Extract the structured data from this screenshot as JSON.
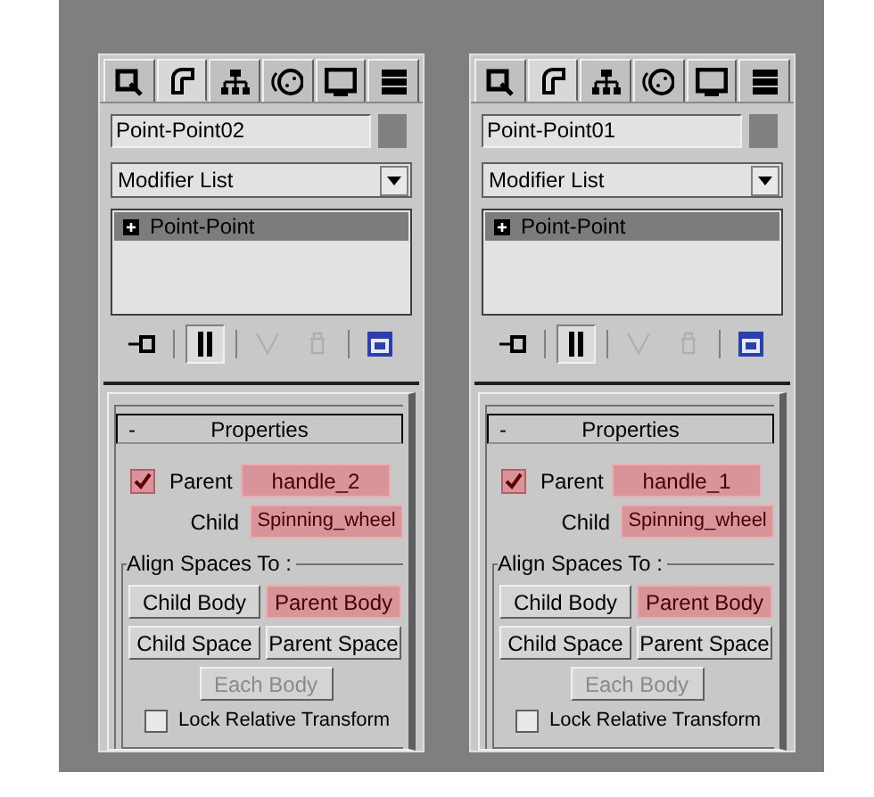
{
  "panels": [
    {
      "tabs": [
        {
          "kind": "create",
          "selected": false
        },
        {
          "kind": "modify",
          "selected": true
        },
        {
          "kind": "hierarchy",
          "selected": false
        },
        {
          "kind": "motion",
          "selected": false
        },
        {
          "kind": "display",
          "selected": false
        },
        {
          "kind": "utilities",
          "selected": false
        }
      ],
      "object_name": "Point-Point02",
      "modifier_list": "Modifier List",
      "stack": [
        {
          "label": "Point-Point",
          "selected": true
        }
      ],
      "toolbar": [
        {
          "kind": "pin",
          "pressed": false,
          "disabled": false
        },
        {
          "kind": "end-result",
          "pressed": true,
          "disabled": false
        },
        {
          "kind": "unique",
          "pressed": false,
          "disabled": true
        },
        {
          "kind": "remove",
          "pressed": false,
          "disabled": true
        },
        {
          "kind": "configure",
          "pressed": false,
          "disabled": false
        }
      ],
      "rollout": {
        "toggle": "-",
        "title": "Properties",
        "parent_checked": true,
        "parent_label": "Parent",
        "parent_value": "handle_2",
        "child_label": "Child",
        "child_value": "Spinning_wheel",
        "align_label": "Align Spaces To :",
        "buttons": [
          {
            "label": "Child Body",
            "selected": false,
            "disabled": false
          },
          {
            "label": "Parent Body",
            "selected": true,
            "disabled": false
          },
          {
            "label": "Child Space",
            "selected": false,
            "disabled": false
          },
          {
            "label": "Parent Space",
            "selected": false,
            "disabled": false
          },
          {
            "label": "Each Body",
            "selected": false,
            "disabled": true
          }
        ],
        "lock_checked": false,
        "lock_label": "Lock Relative Transform"
      }
    },
    {
      "tabs": [
        {
          "kind": "create",
          "selected": false
        },
        {
          "kind": "modify",
          "selected": true
        },
        {
          "kind": "hierarchy",
          "selected": false
        },
        {
          "kind": "motion",
          "selected": false
        },
        {
          "kind": "display",
          "selected": false
        },
        {
          "kind": "utilities",
          "selected": false
        }
      ],
      "object_name": "Point-Point01",
      "modifier_list": "Modifier List",
      "stack": [
        {
          "label": "Point-Point",
          "selected": true
        }
      ],
      "toolbar": [
        {
          "kind": "pin",
          "pressed": false,
          "disabled": false
        },
        {
          "kind": "end-result",
          "pressed": true,
          "disabled": false
        },
        {
          "kind": "unique",
          "pressed": false,
          "disabled": true
        },
        {
          "kind": "remove",
          "pressed": false,
          "disabled": true
        },
        {
          "kind": "configure",
          "pressed": false,
          "disabled": false
        }
      ],
      "rollout": {
        "toggle": "-",
        "title": "Properties",
        "parent_checked": true,
        "parent_label": "Parent",
        "parent_value": "handle_1",
        "child_label": "Child",
        "child_value": "Spinning_wheel",
        "align_label": "Align Spaces To :",
        "buttons": [
          {
            "label": "Child Body",
            "selected": false,
            "disabled": false
          },
          {
            "label": "Parent Body",
            "selected": true,
            "disabled": false
          },
          {
            "label": "Child Space",
            "selected": false,
            "disabled": false
          },
          {
            "label": "Parent Space",
            "selected": false,
            "disabled": false
          },
          {
            "label": "Each Body",
            "selected": false,
            "disabled": true
          }
        ],
        "lock_checked": false,
        "lock_label": "Lock Relative Transform"
      }
    }
  ]
}
